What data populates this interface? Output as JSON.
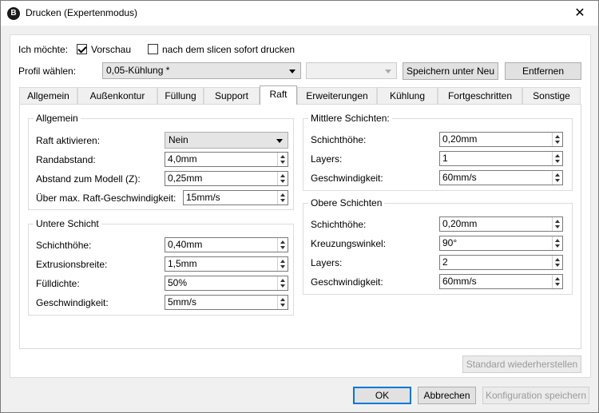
{
  "window": {
    "title": "Drucken (Expertenmodus)",
    "icon": "B",
    "close_glyph": "✕"
  },
  "top": {
    "want_label": "Ich möchte:",
    "preview_label": "Vorschau",
    "preview_checked": true,
    "print_after_slice_label": "nach dem slicen sofort drucken",
    "print_after_slice_checked": false,
    "profile_label": "Profil wählen:",
    "profile_value": "0,05-Kühlung *",
    "second_select_value": "",
    "save_as_new_label": "Speichern unter Neu",
    "remove_label": "Entfernen"
  },
  "tabs": [
    "Allgemein",
    "Außenkontur",
    "Füllung",
    "Support",
    "Raft",
    "Erweiterungen",
    "Kühlung",
    "Fortgeschritten",
    "Sonstige"
  ],
  "active_tab": "Raft",
  "raft": {
    "general": {
      "title": "Allgemein",
      "fields": [
        {
          "label": "Raft aktivieren:",
          "value": "Nein",
          "type": "select"
        },
        {
          "label": "Randabstand:",
          "value": "4,0mm",
          "type": "spin"
        },
        {
          "label": "Abstand zum Modell (Z):",
          "value": "0,25mm",
          "type": "spin"
        },
        {
          "label": "Über max. Raft-Geschwindigkeit:",
          "value": "15mm/s",
          "type": "spin"
        }
      ]
    },
    "lower_layer": {
      "title": "Untere Schicht",
      "fields": [
        {
          "label": "Schichthöhe:",
          "value": "0,40mm"
        },
        {
          "label": "Extrusionsbreite:",
          "value": "1,5mm"
        },
        {
          "label": "Fülldichte:",
          "value": "50%"
        },
        {
          "label": "Geschwindigkeit:",
          "value": "5mm/s"
        }
      ]
    },
    "middle_layers": {
      "title": "Mittlere Schichten:",
      "fields": [
        {
          "label": "Schichthöhe:",
          "value": "0,20mm"
        },
        {
          "label": "Layers:",
          "value": "1"
        },
        {
          "label": "Geschwindigkeit:",
          "value": "60mm/s"
        }
      ]
    },
    "upper_layers": {
      "title": "Obere Schichten",
      "fields": [
        {
          "label": "Schichthöhe:",
          "value": "0,20mm"
        },
        {
          "label": "Kreuzungswinkel:",
          "value": "90°"
        },
        {
          "label": "Layers:",
          "value": "2"
        },
        {
          "label": "Geschwindigkeit:",
          "value": "60mm/s"
        }
      ]
    }
  },
  "restore_defaults_label": "Standard wiederherstellen",
  "footer": {
    "ok_label": "OK",
    "cancel_label": "Abbrechen",
    "save_config_label": "Konfiguration speichern"
  },
  "colors": {
    "accent": "#0078d7",
    "disabled_text": "#9a9a9a"
  }
}
